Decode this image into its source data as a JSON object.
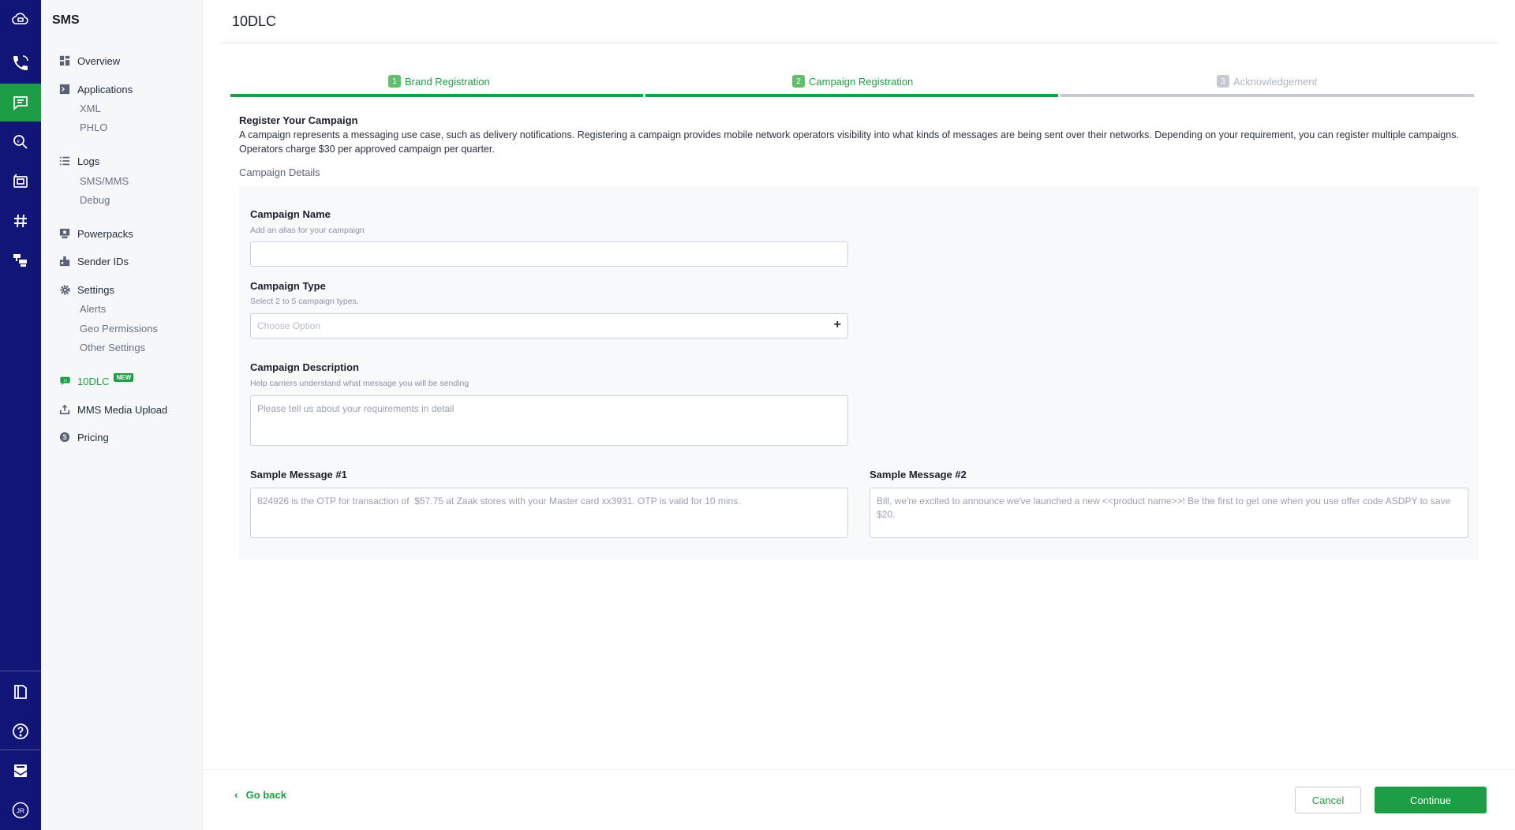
{
  "rail": {
    "icons": [
      "cloud-logo-icon",
      "phone-call-icon",
      "sms-chat-icon",
      "number-lookup-icon",
      "fax-icon",
      "phone-numbers-hash-icon",
      "flows-icon",
      "docs-book-icon",
      "help-icon",
      "inbox-icon",
      "account-avatar-icon"
    ],
    "account_initials": "JR"
  },
  "sidebar": {
    "title": "SMS",
    "items": [
      {
        "label": "Overview",
        "icon": "grid-icon"
      },
      {
        "label": "Applications",
        "icon": "terminal-icon",
        "children": [
          "XML",
          "PHLO"
        ]
      },
      {
        "label": "Logs",
        "icon": "list-icon",
        "children": [
          "SMS/MMS",
          "Debug"
        ]
      },
      {
        "label": "Powerpacks",
        "icon": "powerpack-icon"
      },
      {
        "label": "Sender IDs",
        "icon": "sender-id-icon"
      },
      {
        "label": "Settings",
        "icon": "gear-icon",
        "children": [
          "Alerts",
          "Geo Permissions",
          "Other Settings"
        ]
      },
      {
        "label": "10DLC",
        "icon": "10dlc-icon",
        "badge": "NEW",
        "active": true
      },
      {
        "label": "MMS Media Upload",
        "icon": "upload-icon"
      },
      {
        "label": "Pricing",
        "icon": "dollar-icon"
      }
    ]
  },
  "page": {
    "title": "10DLC",
    "steps": [
      {
        "num": "1",
        "label": "Brand Registration",
        "state": "done"
      },
      {
        "num": "2",
        "label": "Campaign Registration",
        "state": "done"
      },
      {
        "num": "3",
        "label": "Acknowledgement",
        "state": "pending"
      }
    ],
    "section_heading": "Register Your Campaign",
    "section_desc": "A campaign represents a messaging use case, such as delivery notifications. Registering a campaign provides mobile network operators visibility into what kinds of messages are being sent over their networks. Depending on your requirement, you can register multiple campaigns. Operators charge $30 per approved campaign per quarter.",
    "details_label": "Campaign Details"
  },
  "form": {
    "campaign_name": {
      "label": "Campaign Name",
      "help": "Add an alias for your campaign",
      "value": ""
    },
    "campaign_type": {
      "label": "Campaign Type",
      "help": "Select 2 to 5 campaign types.",
      "placeholder": "Choose Option"
    },
    "campaign_description": {
      "label": "Campaign Description",
      "help": "Help carriers understand what message you will be sending",
      "placeholder": "Please tell us about your requirements in detail"
    },
    "sample_1": {
      "label": "Sample Message #1",
      "placeholder": "824926 is the OTP for transaction of  $57.75 at Zaak stores with your Master card xx3931. OTP is valid for 10 mins."
    },
    "sample_2": {
      "label": "Sample Message #2",
      "placeholder": "Bill, we're excited to announce we've launched a new <<product name>>! Be the first to get one when you use offer code ASDPY to save $20."
    }
  },
  "footer": {
    "go_back": "Go back",
    "cancel": "Cancel",
    "continue": "Continue"
  },
  "colors": {
    "rail": "#111575",
    "accent": "#1e9e44",
    "pending": "#c5c9d2"
  }
}
